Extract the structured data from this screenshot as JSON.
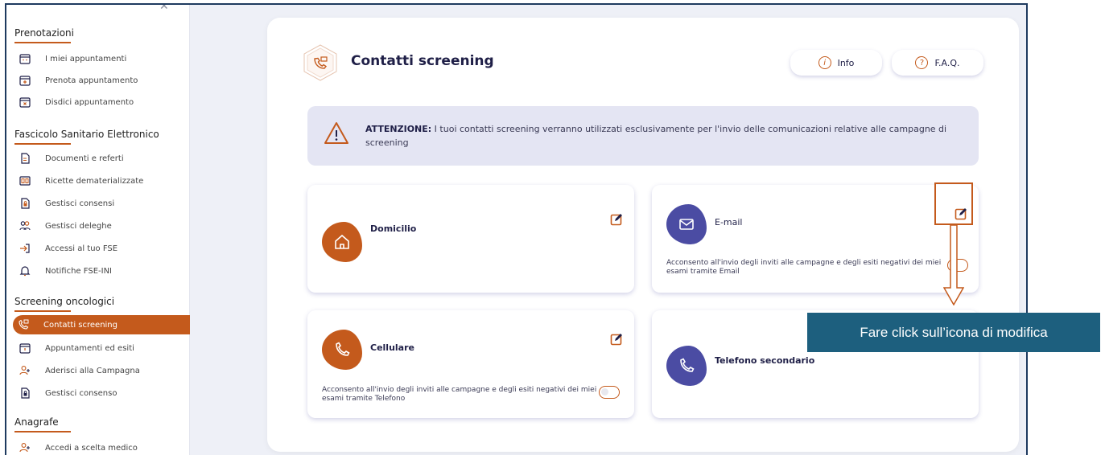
{
  "sidebar": {
    "sections": [
      {
        "title": "Prenotazioni",
        "items": [
          "I miei appuntamenti",
          "Prenota appuntamento",
          "Disdici appuntamento"
        ]
      },
      {
        "title": "Fascicolo Sanitario Elettronico",
        "items": [
          "Documenti e referti",
          "Ricette dematerializzate",
          "Gestisci consensi",
          "Gestisci deleghe",
          "Accessi al tuo FSE",
          "Notifiche FSE-INI"
        ]
      },
      {
        "title": "Screening oncologici",
        "items": [
          "Contatti screening",
          "Appuntamenti ed esiti",
          "Aderisci alla Campagna",
          "Gestisci consenso"
        ]
      },
      {
        "title": "Anagrafe",
        "items": [
          "Accedi a scelta medico"
        ]
      }
    ]
  },
  "main": {
    "title": "Contatti screening",
    "info_label": "Info",
    "faq_label": "F.A.Q.",
    "alert": {
      "strong": "ATTENZIONE:",
      "text": " I tuoi contatti screening verranno utilizzati esclusivamente per l'invio delle comunicazioni relative alle campagne di screening"
    },
    "tiles": {
      "domicilio": {
        "title": "Domicilio"
      },
      "email": {
        "title": "E-mail",
        "consent": "Acconsento all'invio degli inviti alle campagne e degli esiti negativi dei miei esami tramite Email"
      },
      "cellulare": {
        "title": "Cellulare",
        "consent": "Acconsento all'invio degli inviti alle campagne e degli esiti negativi dei miei esami tramite Telefono"
      },
      "telefono": {
        "title": "Telefono secondario"
      }
    }
  },
  "annotation": {
    "callout": "Fare click sull’icona di modifica"
  },
  "colors": {
    "accent": "#c45a1c",
    "purple": "#4b4ca3",
    "callout": "#1d5f7e",
    "border": "#1e3a5f"
  }
}
